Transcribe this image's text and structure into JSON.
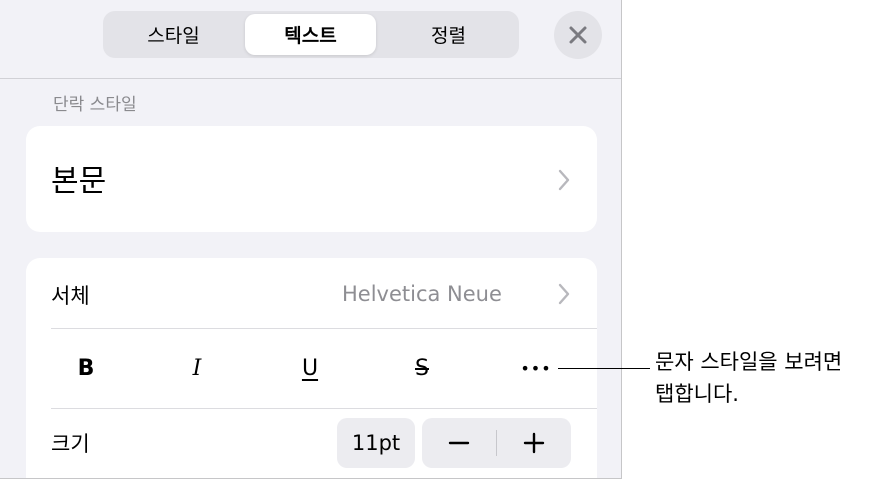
{
  "tabs": [
    {
      "label": "스타일"
    },
    {
      "label": "텍스트"
    },
    {
      "label": "정렬"
    }
  ],
  "paragraph_style": {
    "section_label": "단락 스타일",
    "value": "본문"
  },
  "font": {
    "label": "서체",
    "value": "Helvetica Neue"
  },
  "format_buttons": {
    "bold": "B",
    "italic": "I",
    "underline": "U",
    "strikethrough": "S",
    "more": "•••"
  },
  "size": {
    "label": "크기",
    "value": "11pt"
  },
  "callout": {
    "line1": "문자 스타일을 보려면",
    "line2": "탭합니다."
  },
  "colors": {
    "panel_bg": "#f2f2f7",
    "card_bg": "#ffffff",
    "secondary_text": "#8e8e93"
  }
}
